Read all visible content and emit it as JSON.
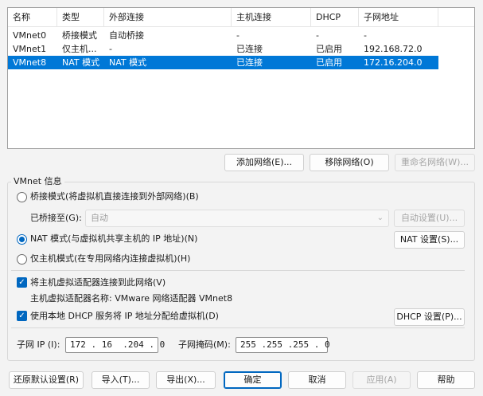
{
  "network_table": {
    "columns": [
      "名称",
      "类型",
      "外部连接",
      "主机连接",
      "DHCP",
      "子网地址"
    ],
    "rows": [
      {
        "name": "VMnet0",
        "type": "桥接模式",
        "external": "自动桥接",
        "host": "-",
        "dhcp": "-",
        "subnet": "-"
      },
      {
        "name": "VMnet1",
        "type": "仅主机...",
        "external": "-",
        "host": "已连接",
        "dhcp": "已启用",
        "subnet": "192.168.72.0"
      },
      {
        "name": "VMnet8",
        "type": "NAT 模式",
        "external": "NAT 模式",
        "host": "已连接",
        "dhcp": "已启用",
        "subnet": "172.16.204.0"
      }
    ],
    "selected_row": 2
  },
  "table_buttons": {
    "add": "添加网络(E)...",
    "remove": "移除网络(O)",
    "rename": "重命名网络(W)..."
  },
  "vmnet_info": {
    "title": "VMnet 信息",
    "bridged_label": "桥接模式(将虚拟机直接连接到外部网络)(B)",
    "bridged_to_label": "已桥接至(G):",
    "bridged_to_value": "自动",
    "auto_settings": "自动设置(U)...",
    "nat_label": "NAT 模式(与虚拟机共享主机的 IP 地址)(N)",
    "nat_settings": "NAT 设置(S)...",
    "hostonly_label": "仅主机模式(在专用网络内连接虚拟机)(H)",
    "connect_adapter_label": "将主机虚拟适配器连接到此网络(V)",
    "adapter_name_label": "主机虚拟适配器名称: VMware 网络适配器 VMnet8",
    "dhcp_label": "使用本地 DHCP 服务将 IP 地址分配给虚拟机(D)",
    "dhcp_settings": "DHCP 设置(P)...",
    "subnet_ip_label": "子网 IP (I):",
    "subnet_ip": "172 . 16  .204 . 0",
    "subnet_mask_label": "子网掩码(M):",
    "subnet_mask": "255 .255 .255 . 0"
  },
  "footer": {
    "restore": "还原默认设置(R)",
    "import": "导入(T)...",
    "export": "导出(X)...",
    "ok": "确定",
    "cancel": "取消",
    "apply": "应用(A)",
    "help": "帮助"
  },
  "colors": {
    "selection": "#0078d7",
    "accent": "#0067c0",
    "window_bg": "#f3f3f3"
  }
}
